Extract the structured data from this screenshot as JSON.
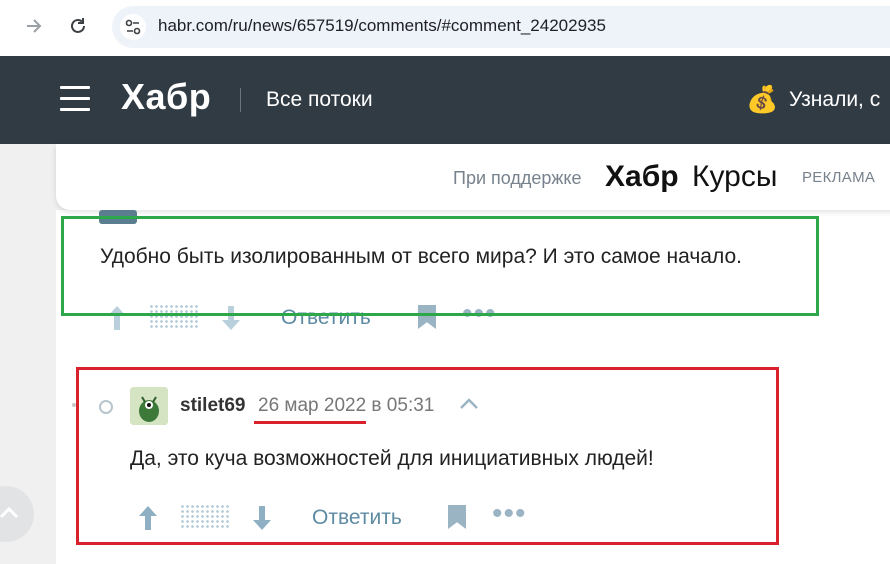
{
  "browser": {
    "url": "habr.com/ru/news/657519/comments/#comment_24202935"
  },
  "header": {
    "logo": "Хабр",
    "streams": "Все потоки",
    "promo_icon": "moneybag-emoji",
    "promo_text": "Узнали, с"
  },
  "sponsor": {
    "label": "При поддержке",
    "brand": "Хабр",
    "courses": "Курсы",
    "ad": "РЕКЛАМА"
  },
  "comment1": {
    "text": "Удобно быть изолированным от всего мира? И это самое начало.",
    "reply": "Ответить"
  },
  "comment2": {
    "username": "stilet69",
    "date": "26 мар 2022 в 05:31",
    "text": "Да, это куча возможностей для инициативных людей!",
    "reply": "Ответить"
  },
  "colors": {
    "header_bg": "#303b44",
    "highlight_green": "#2ca84a",
    "highlight_red": "#d8212b",
    "link": "#5e8ba3"
  }
}
